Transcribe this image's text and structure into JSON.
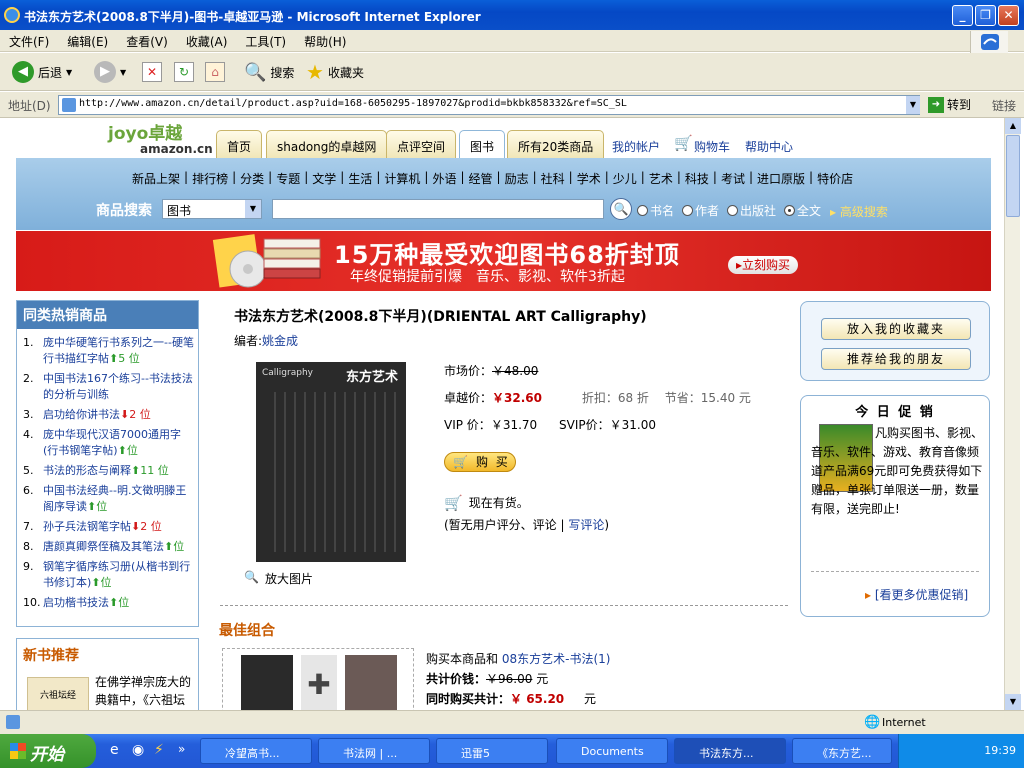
{
  "window": {
    "title": "书法东方艺术(2008.8下半月)-图书-卓越亚马逊 - Microsoft Internet Explorer"
  },
  "menu": [
    "文件(F)",
    "编辑(E)",
    "查看(V)",
    "收藏(A)",
    "工具(T)",
    "帮助(H)"
  ],
  "toolbar": {
    "back": "后退",
    "search": "搜索",
    "favorites": "收藏夹"
  },
  "address": {
    "label": "地址(D)",
    "url": "http://www.amazon.cn/detail/product.asp?uid=168-6050295-1897027&prodid=bkbk858332&ref=SC_SL",
    "go": "转到",
    "links": "链接"
  },
  "site": {
    "logo_joyo": "joyo卓越",
    "logo_amazon": "amazon.cn",
    "tabs": [
      "首页",
      "shadong的卓越网",
      "点评空间",
      "图书",
      "所有20类商品"
    ],
    "account_links": [
      "我的帐户",
      "购物车",
      "帮助中心"
    ],
    "categories": [
      "新品上架",
      "排行榜",
      "分类",
      "专题",
      "文学",
      "生活",
      "计算机",
      "外语",
      "经管",
      "励志",
      "社科",
      "学术",
      "少儿",
      "艺术",
      "科技",
      "考试",
      "进口原版",
      "特价店"
    ],
    "search": {
      "label": "商品搜索",
      "select": "图书",
      "options": [
        "书名",
        "作者",
        "出版社",
        "全文"
      ],
      "selected": "全文",
      "advanced": "高级搜索"
    },
    "banner": {
      "main": "15万种最受欢迎图书68折封顶",
      "sub": "年终促销提前引爆　音乐、影视、软件3折起",
      "button": "立刻购买"
    }
  },
  "bestsellers": {
    "title": "同类热销商品",
    "items": [
      {
        "n": "1.",
        "text": "庞中华硬笔行书系列之一--硬笔行书描红字帖",
        "trend": "up",
        "delta": "5 位"
      },
      {
        "n": "2.",
        "text": "中国书法167个练习--书法技法的分析与训练",
        "trend": "",
        "delta": ""
      },
      {
        "n": "3.",
        "text": "启功给你讲书法",
        "trend": "down",
        "delta": "2 位"
      },
      {
        "n": "4.",
        "text": "庞中华现代汉语7000通用字(行书钢笔字帖)",
        "trend": "up",
        "delta": "位"
      },
      {
        "n": "5.",
        "text": "书法的形态与阐释",
        "trend": "up",
        "delta": "11 位"
      },
      {
        "n": "6.",
        "text": "中国书法经典--明.文徵明滕王阁序导读",
        "trend": "up",
        "delta": "位"
      },
      {
        "n": "7.",
        "text": "孙子兵法钢笔字帖",
        "trend": "down",
        "delta": "2 位"
      },
      {
        "n": "8.",
        "text": "唐颜真卿祭侄稿及其笔法",
        "trend": "up",
        "delta": "位"
      },
      {
        "n": "9.",
        "text": "钢笔字循序练习册(从楷书到行书修订本)",
        "trend": "up",
        "delta": "位"
      },
      {
        "n": "10.",
        "text": "启功楷书技法",
        "trend": "up",
        "delta": "位"
      }
    ]
  },
  "newbooks": {
    "title": "新书推荐",
    "desc": "在佛学禅宗庞大的典籍中，《六祖坛"
  },
  "product": {
    "title": "书法东方艺术(2008.8下半月)(DRIENTAL ART Calligraphy)",
    "editor_label": "编者:",
    "editor": "姚金成",
    "cover_text_en": "Calligraphy",
    "cover_text_cn": "东方艺术",
    "market_label": "市场价：",
    "market_price": "￥48.00",
    "joyo_label": "卓越价：",
    "joyo_price": "￥32.60",
    "discount_label": "折扣：",
    "discount": "68 折",
    "save_label": "节省：",
    "save": "15.40 元",
    "vip_label": "VIP 价：",
    "vip_price": "￥31.70",
    "svip_label": "SVIP价：",
    "svip_price": "￥31.00",
    "buy": "购 买",
    "stock": "现在有货。",
    "review_note": "(暂无用户评分、评论",
    "review_link": "写评论",
    "review_close": ")",
    "enlarge": "放大图片"
  },
  "combo": {
    "title": "最佳组合",
    "buy_line_prefix": "购买本商品和",
    "buy_line_link": "08东方艺术-书法(1)",
    "total_label": "共计价钱：",
    "total_price": "￥96.00",
    "together_label": "同时购买共计：",
    "together_price": "￥ 65.20",
    "unit": "元"
  },
  "side": {
    "fav_button": "放入我的收藏夹",
    "recommend_button": "推荐给我的朋友",
    "promo_title": "今 日 促 销",
    "promo_text": "凡购买图书、影视、音乐、软件、游戏、教育音像频道产品满69元即可免费获得如下赠品，单张订单限送一册，数量有限，送完即止!",
    "promo_more": "[看更多优惠促销]"
  },
  "status": {
    "zone": "Internet"
  },
  "taskbar": {
    "start": "开始",
    "tasks": [
      "冷望高书...",
      "书法网 | ...",
      "迅雷5",
      "Documents",
      "书法东方...",
      "《东方艺..."
    ],
    "clock": "19:39"
  }
}
